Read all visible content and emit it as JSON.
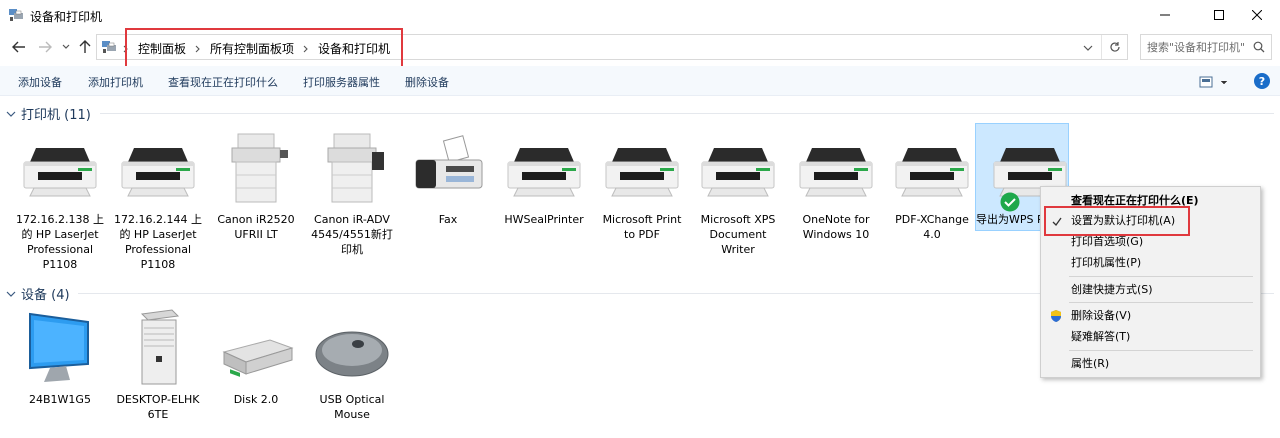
{
  "window": {
    "title": "设备和打印机",
    "minimize_icon": "minimize-icon",
    "maximize_icon": "maximize-icon",
    "close_icon": "close-icon"
  },
  "address_bar": {
    "breadcrumbs": [
      "控制面板",
      "所有控制面板项",
      "设备和打印机"
    ],
    "search_placeholder": "搜索\"设备和打印机\""
  },
  "command_bar": {
    "add_device": "添加设备",
    "add_printer": "添加打印机",
    "see_printing": "查看现在正在打印什么",
    "print_server_props": "打印服务器属性",
    "remove_device": "删除设备",
    "help": "?"
  },
  "groups": {
    "printers": {
      "title": "打印机 (11)",
      "items": [
        {
          "lines": [
            "172.16.2.138 上",
            "的 HP LaserJet",
            "Professional",
            "P1108"
          ]
        },
        {
          "lines": [
            "172.16.2.144 上",
            "的 HP LaserJet",
            "Professional",
            "P1108"
          ]
        },
        {
          "lines": [
            "Canon iR2520",
            "UFRII LT"
          ]
        },
        {
          "lines": [
            "Canon iR-ADV",
            "4545/4551新打",
            "印机"
          ]
        },
        {
          "lines": [
            "Fax"
          ]
        },
        {
          "lines": [
            "HWSealPrinter"
          ]
        },
        {
          "lines": [
            "Microsoft Print",
            "to PDF"
          ]
        },
        {
          "lines": [
            "Microsoft XPS",
            "Document",
            "Writer"
          ]
        },
        {
          "lines": [
            "OneNote for",
            "Windows 10"
          ]
        },
        {
          "lines": [
            "PDF-XChange",
            "4.0"
          ]
        },
        {
          "lines": [
            "导出为WPS PDF"
          ]
        }
      ]
    },
    "devices": {
      "title": "设备 (4)",
      "items": [
        {
          "lines": [
            "24B1W1G5"
          ]
        },
        {
          "lines": [
            "DESKTOP-ELHK",
            "6TE"
          ]
        },
        {
          "lines": [
            "Disk 2.0"
          ]
        },
        {
          "lines": [
            "USB Optical",
            "Mouse"
          ]
        }
      ]
    }
  },
  "context_menu": {
    "items": [
      {
        "label": "查看现在正在打印什么(E)",
        "bold": true
      },
      {
        "label": "设置为默认打印机(A)",
        "checked": true
      },
      {
        "label": "打印首选项(G)"
      },
      {
        "label": "打印机属性(P)"
      },
      {
        "label": "创建快捷方式(S)"
      },
      {
        "label": "删除设备(V)",
        "icon": "shield-icon"
      },
      {
        "label": "疑难解答(T)"
      },
      {
        "label": "属性(R)"
      }
    ]
  },
  "colors": {
    "highlight_red": "#e0393e",
    "selection_bg": "#cce8ff",
    "link_text": "#1e395b",
    "default_check": "#1ea84a"
  }
}
